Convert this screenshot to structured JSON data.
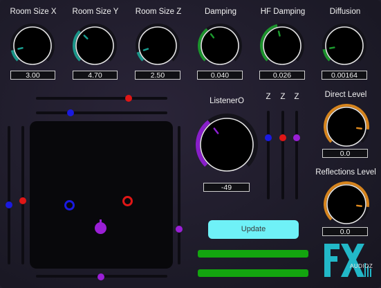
{
  "knobs": {
    "room_size_x": {
      "label": "Room Size X",
      "value": "3.00",
      "color": "#1a9c8f",
      "level": 0.12
    },
    "room_size_y": {
      "label": "Room Size Y",
      "value": "4.70",
      "color": "#1a9c8f",
      "level": 0.33
    },
    "room_size_z": {
      "label": "Room Size Z",
      "value": "2.50",
      "color": "#1a9c8f",
      "level": 0.1
    },
    "damping": {
      "label": "Damping",
      "value": "0.040",
      "color": "#1c9a2e",
      "level": 0.36
    },
    "hf_damping": {
      "label": "HF Damping",
      "value": "0.026",
      "color": "#1c9a2e",
      "level": 0.45
    },
    "diffusion": {
      "label": "Diffusion",
      "value": "0.00164",
      "color": "#1c9a2e",
      "level": 0.13
    }
  },
  "listener": {
    "label": "ListenerO",
    "value": "-49",
    "color": "#8e1fd3",
    "level": 0.36
  },
  "z_labels": [
    "Z",
    "Z",
    "Z"
  ],
  "direct_level": {
    "label": "Direct Level",
    "value": "0.0",
    "color": "#e08a1e",
    "level": 0.86
  },
  "reflections_level": {
    "label": "Reflections Level",
    "value": "0.0",
    "color": "#e08a1e",
    "level": 0.86
  },
  "update_button": {
    "label": "Update"
  },
  "colors": {
    "red": "#e01616",
    "blue": "#1a1ae0",
    "purple": "#9a1fd6",
    "teal_logo": "#22b8c8",
    "green_bar": "#13a50f"
  },
  "logo": {
    "mark": "FX",
    "sub": "AUDIOZ"
  }
}
